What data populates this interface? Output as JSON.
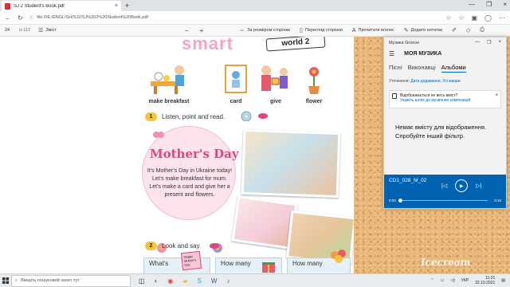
{
  "browser": {
    "tab_title": "SJ 2 Student's Book.pdf",
    "tab_close": "×",
    "new_tab": "+",
    "url": "file:///E:/ENGLISH/SJ2/SJ%202%20Student%20Book.pdf",
    "window_controls": [
      "—",
      "❐",
      "×"
    ]
  },
  "pdf_toolbar": {
    "page": "24",
    "page_of": "із 112",
    "contents": "Зміст",
    "zoom_out": "−",
    "zoom_in": "+",
    "fit": "За розміром сторінки",
    "view": "Перегляд сторінки",
    "read_aloud": "Прочитати вголос",
    "add_notes": "Додати нотатки"
  },
  "page": {
    "brand_smart": "smart",
    "brand_world": "world 2",
    "vocab": [
      "make breakfast",
      "card",
      "give",
      "flower"
    ],
    "ex1_num": "1",
    "ex1_text": "Listen, point and read.",
    "md_title": "Mother's Day",
    "md_body": "It's Mother's Day in Ukraine today! Let's make breakfast for mum. Let's make a card and give her a present and flowers.",
    "ex2_num": "2",
    "ex2_text": "Look and say.",
    "cards": [
      "What's",
      "How many",
      "How many"
    ],
    "card_sign": "Happy Mother's Day"
  },
  "groove": {
    "window_title": "Музика Groove",
    "header_title": "МОЯ МУЗИКА",
    "tabs": [
      "Пісні",
      "Виконавці",
      "Альбоми"
    ],
    "active_tab": 2,
    "filter_label": "Уточнення:",
    "filter_value": "Дата додавання, Усі жанри",
    "notice_q": "Відображається не весь вміст?",
    "notice_link": "Укажіть шлях до музичних композицій",
    "empty_text": "Немає вмісту для відображення. Спробуйте інший фільтр.",
    "track": "CD1_028_M_02",
    "time_start": "0:00",
    "time_end": "0:16",
    "progress": 0.0
  },
  "taskbar": {
    "search_placeholder": "Введіть пошуковий запит тут",
    "lang": "УКР",
    "time": "11:21",
    "date": "22.10.2021"
  },
  "watermark": "Icecream",
  "colors": {
    "groove_accent": "#0063b1",
    "brand_pink": "#f1a6c8",
    "mothers_day": "#e0457b"
  }
}
